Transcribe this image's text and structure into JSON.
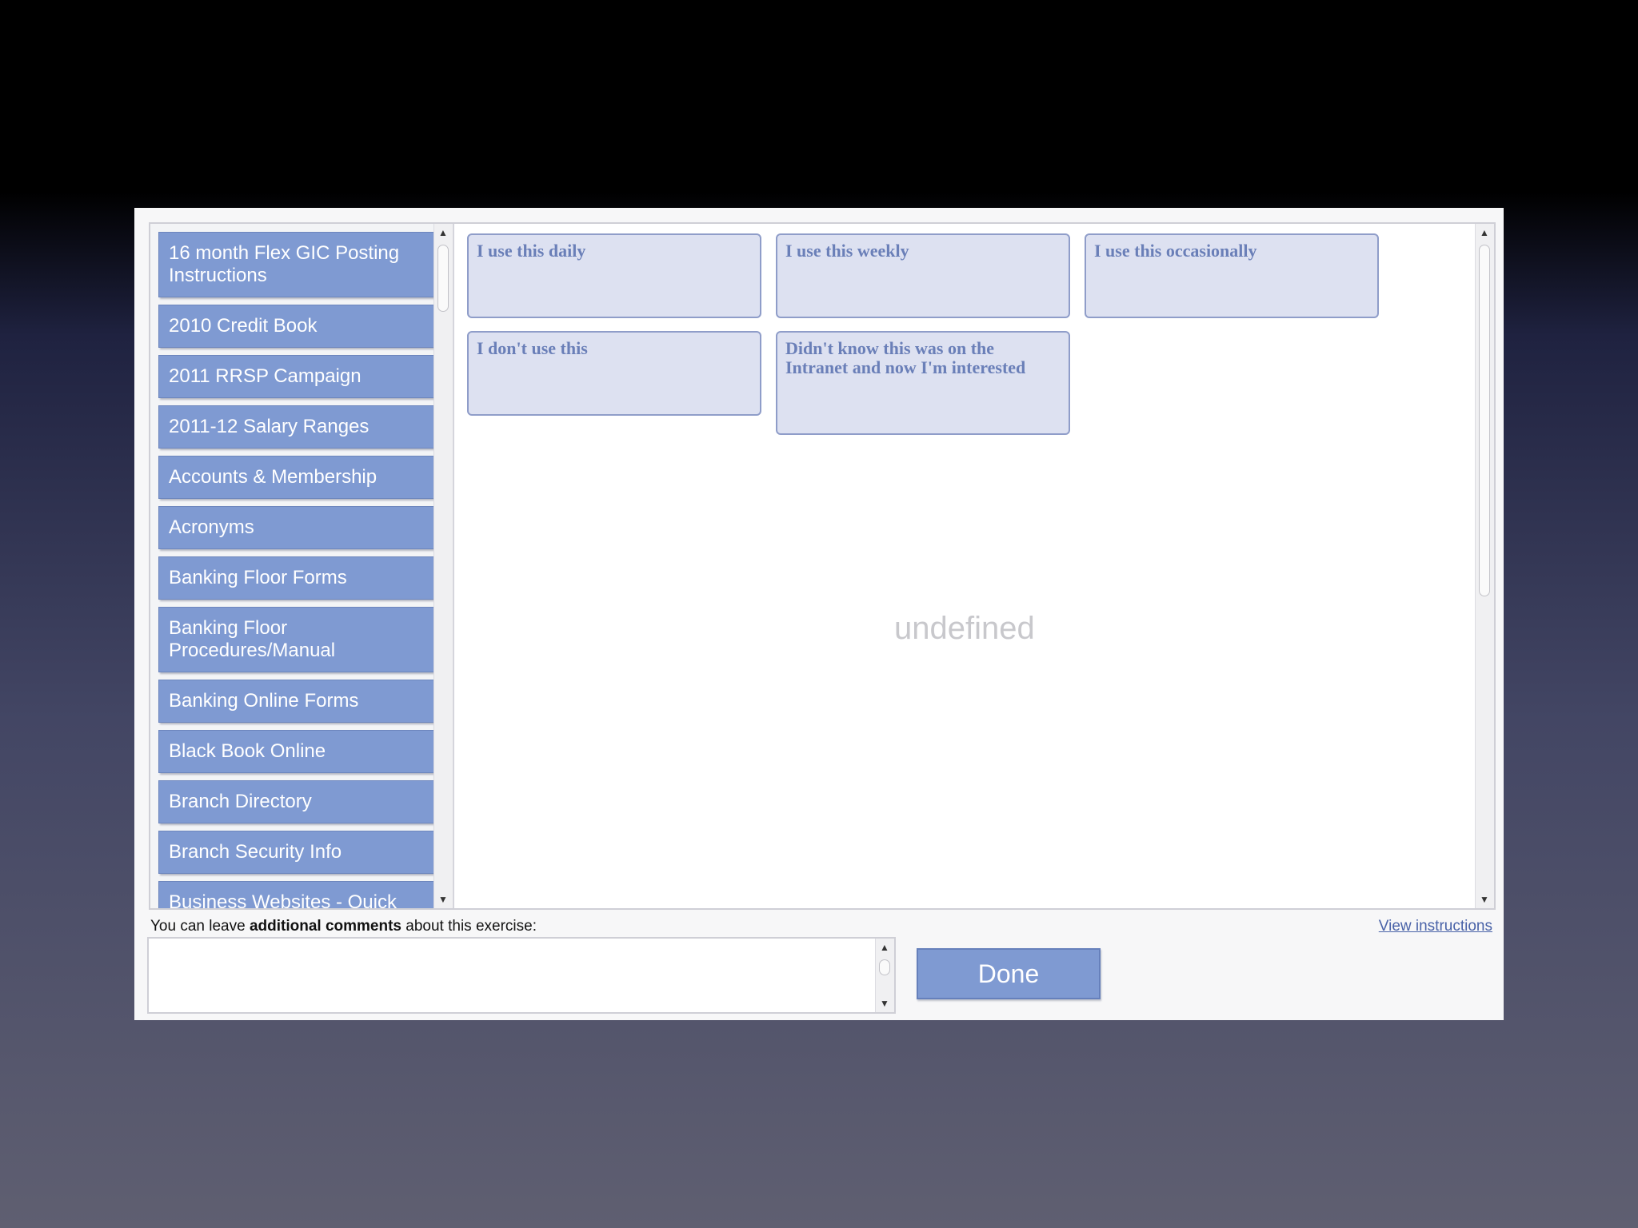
{
  "cards": [
    {
      "label": "16 month Flex GIC Posting Instructions"
    },
    {
      "label": "2010 Credit Book"
    },
    {
      "label": "2011 RRSP Campaign"
    },
    {
      "label": "2011-12 Salary Ranges"
    },
    {
      "label": "Accounts & Membership"
    },
    {
      "label": "Acronyms"
    },
    {
      "label": "Banking Floor Forms"
    },
    {
      "label": "Banking Floor Procedures/Manual"
    },
    {
      "label": "Banking Online Forms"
    },
    {
      "label": "Black Book Online"
    },
    {
      "label": "Branch Directory"
    },
    {
      "label": "Branch Security Info"
    },
    {
      "label": "Business Websites - Quick"
    }
  ],
  "categories": [
    {
      "label": "I use this daily"
    },
    {
      "label": "I use this weekly"
    },
    {
      "label": "I use this occasionally"
    },
    {
      "label": "I don't use this"
    },
    {
      "label": "Didn't know this was on the Intranet and now I'm interested"
    }
  ],
  "drop_area_text": "undefined",
  "comments": {
    "prefix": "You can leave ",
    "bold": "additional comments",
    "suffix": " about this exercise:",
    "value": ""
  },
  "view_instructions": "View instructions",
  "done_label": "Done"
}
